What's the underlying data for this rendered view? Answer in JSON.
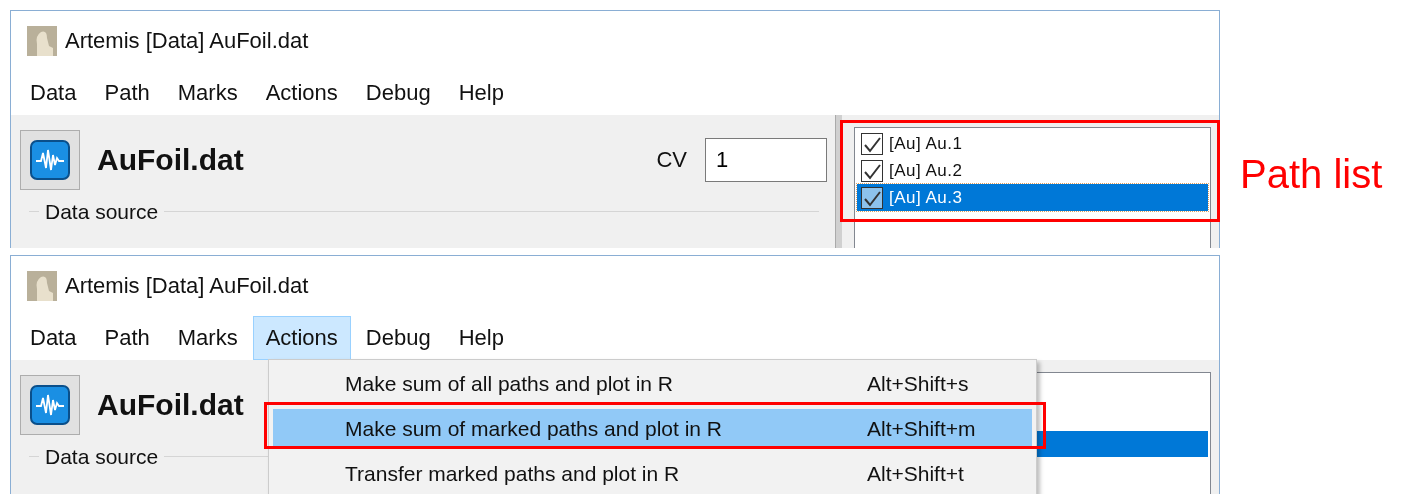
{
  "top_window": {
    "title": "Artemis [Data] AuFoil.dat",
    "menu": [
      {
        "label": "Data",
        "selected": false
      },
      {
        "label": "Path",
        "selected": false
      },
      {
        "label": "Marks",
        "selected": false
      },
      {
        "label": "Actions",
        "selected": false
      },
      {
        "label": "Debug",
        "selected": false
      },
      {
        "label": "Help",
        "selected": false
      }
    ],
    "file_name": "AuFoil.dat",
    "cv_label": "CV",
    "cv_value": "1",
    "paths": [
      {
        "label": "[Au] Au.1",
        "checked": true,
        "selected": false
      },
      {
        "label": "[Au] Au.2",
        "checked": true,
        "selected": false
      },
      {
        "label": "[Au] Au.3",
        "checked": true,
        "selected": true
      }
    ],
    "group_label": "Data source"
  },
  "annotation": "Path list",
  "bottom_window": {
    "title": "Artemis [Data] AuFoil.dat",
    "menu": [
      {
        "label": "Data",
        "selected": false
      },
      {
        "label": "Path",
        "selected": false
      },
      {
        "label": "Marks",
        "selected": false
      },
      {
        "label": "Actions",
        "selected": true
      },
      {
        "label": "Debug",
        "selected": false
      },
      {
        "label": "Help",
        "selected": false
      }
    ],
    "file_name": "AuFoil.dat",
    "group_label": "Data source",
    "actions_menu": [
      {
        "label": "Make sum of all paths and plot in R",
        "shortcut": "Alt+Shift+s",
        "selected": false
      },
      {
        "label": "Make sum of marked paths and plot in R",
        "shortcut": "Alt+Shift+m",
        "selected": true
      },
      {
        "label": "Transfer marked paths and plot in R",
        "shortcut": "Alt+Shift+t",
        "selected": false
      }
    ]
  }
}
